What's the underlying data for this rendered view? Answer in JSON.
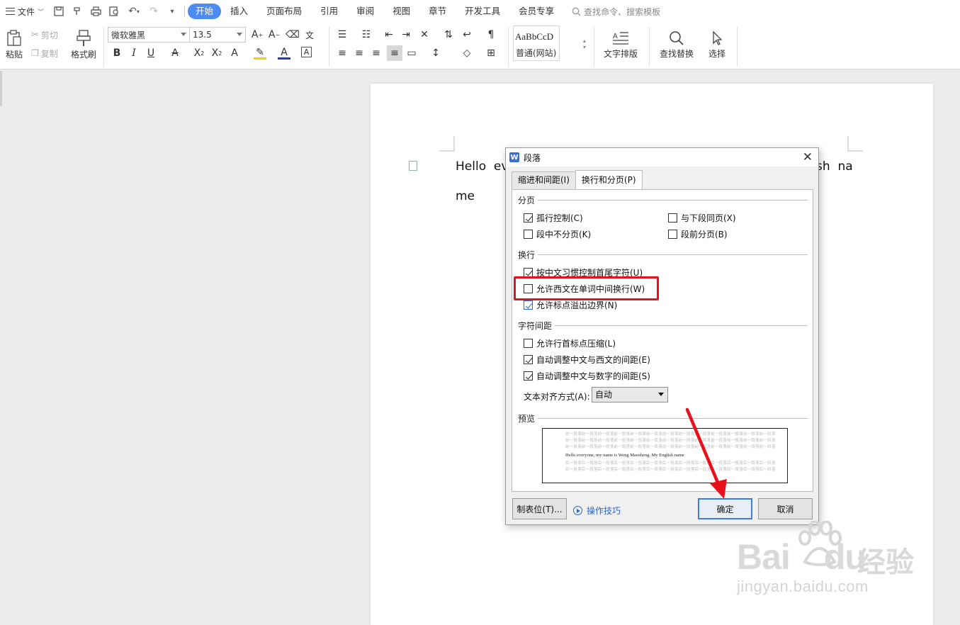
{
  "menubar": {
    "file_label": "文件",
    "tabs": [
      {
        "label": "开始",
        "active": true
      },
      {
        "label": "插入"
      },
      {
        "label": "页面布局"
      },
      {
        "label": "引用"
      },
      {
        "label": "审阅"
      },
      {
        "label": "视图"
      },
      {
        "label": "章节"
      },
      {
        "label": "开发工具"
      },
      {
        "label": "会员专享"
      }
    ],
    "search_placeholder": "查找命令、搜索模板"
  },
  "ribbon": {
    "paste": "粘贴",
    "cut": "剪切",
    "copy": "复制",
    "format_painter": "格式刷",
    "font_name": "微软雅黑",
    "font_size": "13.5",
    "style_preview": "AaBbCcD",
    "style_name": "普通(网站)",
    "text_layout": "文字排版",
    "find_replace": "查找替换",
    "select": "选择"
  },
  "document": {
    "line1_left": "Hello  ev",
    "line1_right": "sh  na",
    "line2": "me"
  },
  "dialog": {
    "title": "段落",
    "close_glyph": "✕",
    "tabs": [
      "缩进和间距(I)",
      "换行和分页(P)"
    ],
    "sections": {
      "pagination": "分页",
      "line_break": "换行",
      "char_spacing": "字符间距",
      "preview": "预览"
    },
    "options": {
      "widow_control": {
        "label": "孤行控制(C)",
        "checked": true
      },
      "keep_with_next": {
        "label": "与下段同页(X)",
        "checked": false
      },
      "keep_lines": {
        "label": "段中不分页(K)",
        "checked": false
      },
      "page_break_before": {
        "label": "段前分页(B)",
        "checked": false
      },
      "chinese_rules": {
        "label": "按中文习惯控制首尾字符(U)",
        "checked": true
      },
      "allow_word_wrap": {
        "label": "允许西文在单词中间换行(W)",
        "checked": false
      },
      "allow_punct_overflow": {
        "label": "允许标点溢出边界(N)",
        "checked": true
      },
      "compress_punct": {
        "label": "允许行首标点压缩(L)",
        "checked": false
      },
      "auto_space_cn_en": {
        "label": "自动调整中文与西文的间距(E)",
        "checked": true
      },
      "auto_space_cn_num": {
        "label": "自动调整中文与数字的间距(S)",
        "checked": true
      }
    },
    "text_align_label": "文本对齐方式(A):",
    "text_align_value": "自动",
    "preview_gray": "前一段落前一段落前一段落前一段落前一段落前一段落前一段落前一段落前一段落前一段落前一段落前一段落前一段落",
    "preview_gray_after": "后一段落后一段落后一段落后一段落后一段落后一段落后一段落后一段落后一段落后一段落后一段落后一段落后一段落",
    "preview_text": "Hello everyone, my name is Weng Maosheng. My English name",
    "buttons": {
      "tabs_btn": "制表位(T)...",
      "tips": "操作技巧",
      "ok": "确定",
      "cancel": "取消"
    }
  },
  "watermark": {
    "brand_latin": "Bai",
    "brand_du": "du",
    "brand_cn": "经验",
    "url": "jingyan.baidu.com"
  },
  "colors": {
    "accent": "#4d8cf5",
    "highlight_box": "#e8111b",
    "arrow": "#e8111b"
  }
}
